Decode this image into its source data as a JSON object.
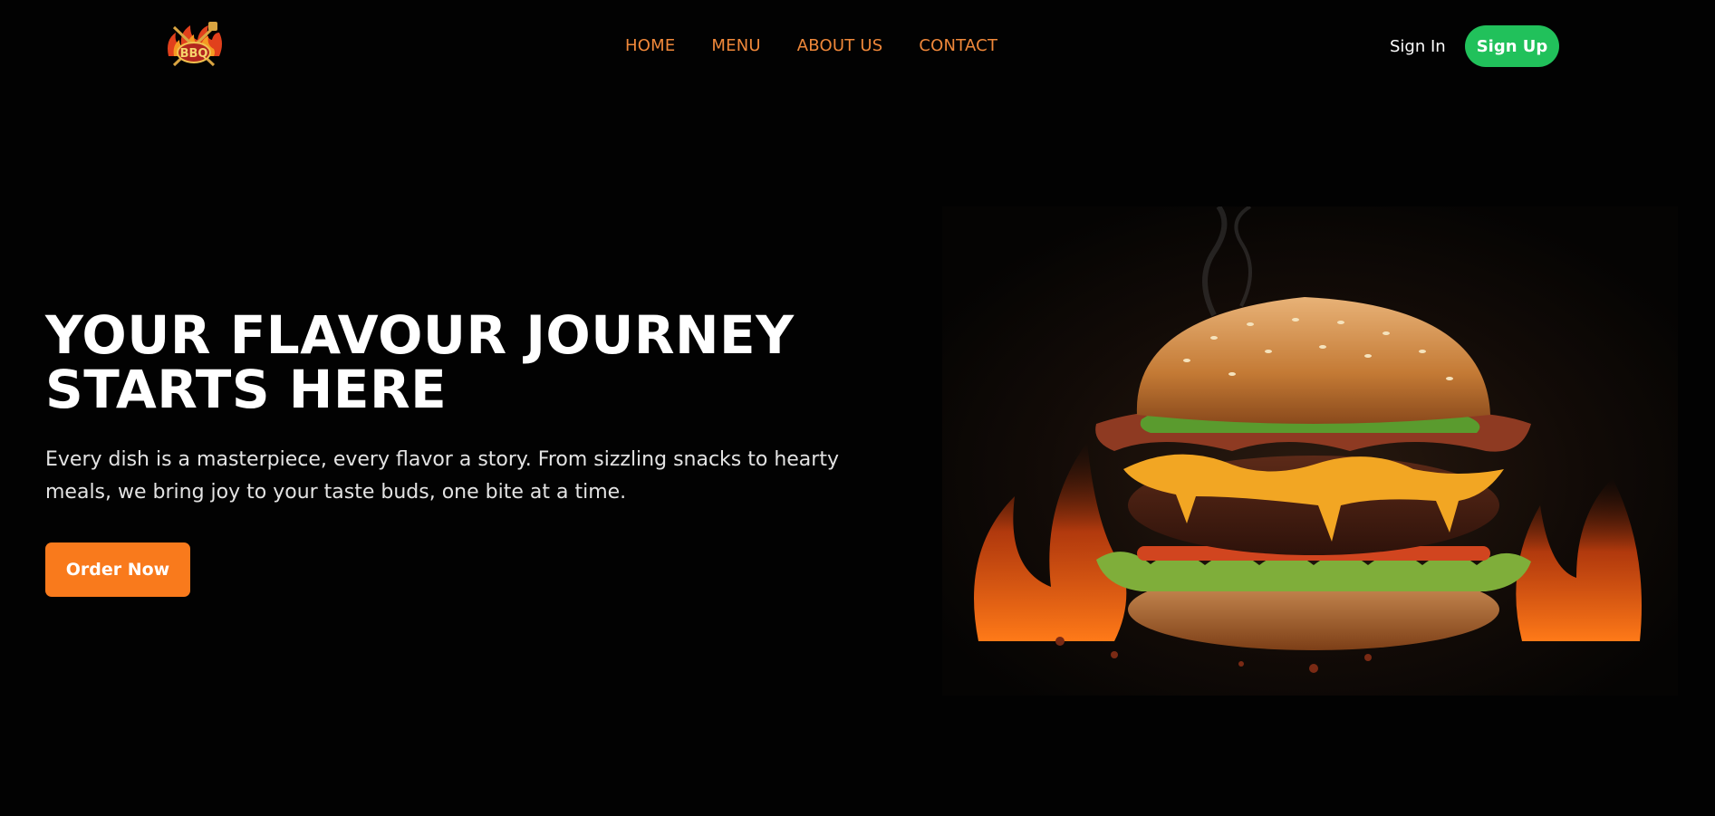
{
  "header": {
    "logo_text": "BBQ",
    "nav": [
      "HOME",
      "MENU",
      "ABOUT US",
      "CONTACT"
    ],
    "sign_in": "Sign In",
    "sign_up": "Sign Up"
  },
  "hero": {
    "title_line1": "YOUR FLAVOUR JOURNEY",
    "title_line2": "STARTS HERE",
    "description": "Every dish is a masterpiece, every flavor a story. From sizzling snacks to hearty meals, we bring joy to your taste buds, one bite at a time.",
    "cta": "Order Now"
  },
  "colors": {
    "background": "#020202",
    "nav_link": "#f0883a",
    "signup_bg": "#21c15b",
    "cta_bg": "#f97a1c"
  },
  "images": {
    "logo": "bbq-flame-logo",
    "hero": "burger-with-flames"
  }
}
